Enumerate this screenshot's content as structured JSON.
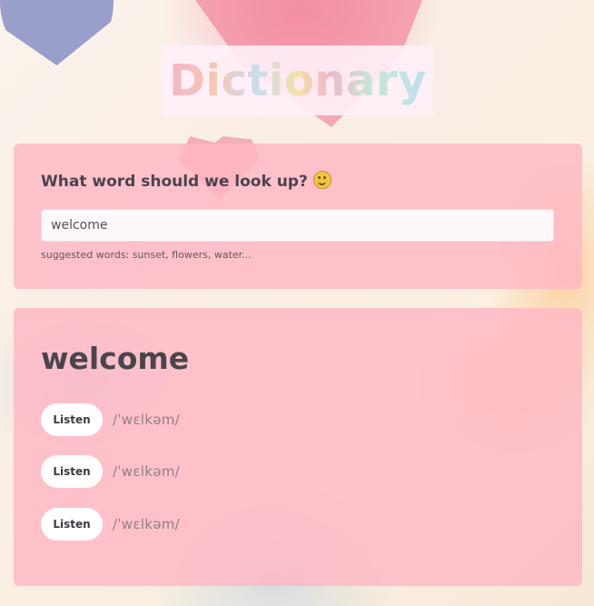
{
  "header": {
    "title": "Dictionary"
  },
  "search": {
    "prompt": "What word should we look up?",
    "value": "welcome",
    "hint": "suggested words: sunset, flowers, water..."
  },
  "result": {
    "word": "welcome",
    "phonetics": [
      {
        "button_label": "Listen",
        "text": "/ˈwɛlkəm/"
      },
      {
        "button_label": "Listen",
        "text": "/ˈwɛlkəm/"
      },
      {
        "button_label": "Listen",
        "text": "/ˈwɛlkəm/"
      }
    ]
  },
  "icons": {
    "prompt_emoji": "smiling-face-emoji"
  },
  "colors": {
    "card": "#ffb7c5",
    "button": "#ffffff",
    "heading_text": "#4a454c"
  }
}
